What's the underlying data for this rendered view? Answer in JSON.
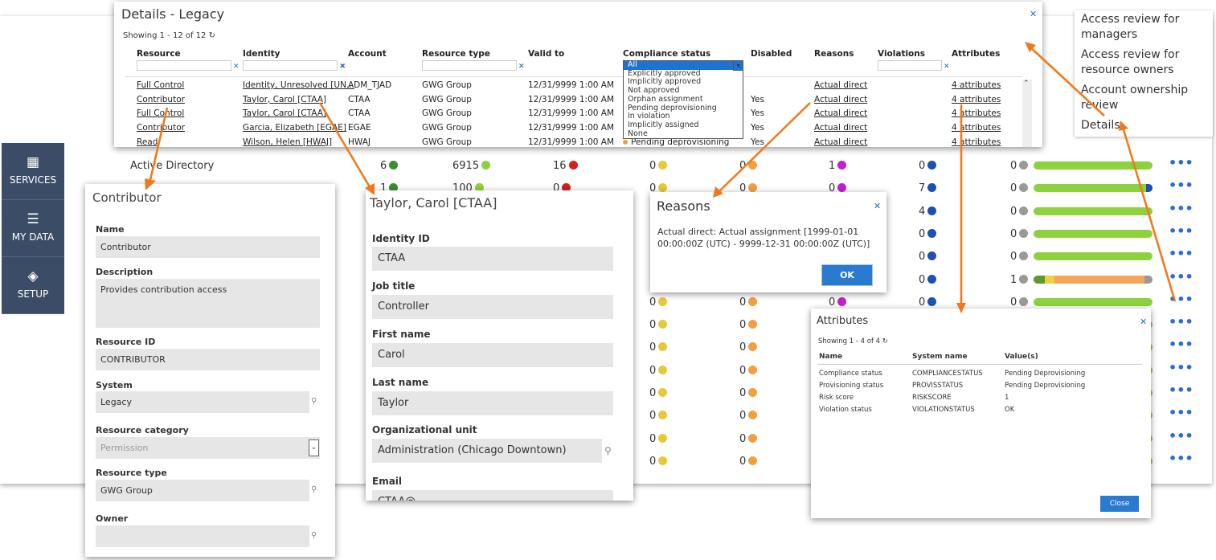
{
  "nav": [
    {
      "icon": "grid-icon",
      "label": "SERVICES"
    },
    {
      "icon": "list-icon",
      "label": "MY DATA"
    },
    {
      "icon": "layers-icon",
      "label": "SETUP"
    }
  ],
  "bg_rows": [
    {
      "system": "Active Directory",
      "c1": "6",
      "c2": "6915",
      "c3": "16",
      "c4": "0",
      "c5": "0",
      "c6": "1",
      "c7": "0",
      "c8": "0"
    },
    {
      "system": "",
      "c1": "1",
      "c2": "100",
      "c3": "0",
      "c4": "0",
      "c5": "0",
      "c6": "0",
      "c7": "7",
      "c8": "0"
    },
    {
      "system": "",
      "c1": "",
      "c2": "",
      "c3": "",
      "c4": "",
      "c5": "",
      "c6": "",
      "c7": "4",
      "c8": "0"
    },
    {
      "system": "",
      "c1": "",
      "c2": "",
      "c3": "",
      "c4": "",
      "c5": "",
      "c6": "",
      "c7": "0",
      "c8": "0"
    },
    {
      "system": "",
      "c1": "",
      "c2": "",
      "c3": "",
      "c4": "",
      "c5": "",
      "c6": "",
      "c7": "0",
      "c8": "0"
    },
    {
      "system": "",
      "c1": "",
      "c2": "",
      "c3": "",
      "c4": "",
      "c5": "",
      "c6": "",
      "c7": "0",
      "c8": "1"
    },
    {
      "system": "",
      "c1": "",
      "c2": "",
      "c3": "",
      "c4": "0",
      "c5": "0",
      "c6": "0",
      "c7": "0",
      "c8": "0"
    },
    {
      "system": "",
      "c1": "",
      "c2": "",
      "c3": "",
      "c4": "0",
      "c5": "0",
      "c6": "",
      "c7": "",
      "c8": ""
    },
    {
      "system": "",
      "c1": "",
      "c2": "",
      "c3": "",
      "c4": "0",
      "c5": "0",
      "c6": "",
      "c7": "",
      "c8": ""
    },
    {
      "system": "",
      "c1": "",
      "c2": "",
      "c3": "",
      "c4": "0",
      "c5": "0",
      "c6": "",
      "c7": "",
      "c8": ""
    },
    {
      "system": "",
      "c1": "",
      "c2": "",
      "c3": "",
      "c4": "0",
      "c5": "0",
      "c6": "",
      "c7": "",
      "c8": ""
    },
    {
      "system": "",
      "c1": "",
      "c2": "",
      "c3": "",
      "c4": "0",
      "c5": "0",
      "c6": "",
      "c7": "",
      "c8": ""
    },
    {
      "system": "",
      "c1": "",
      "c2": "",
      "c3": "",
      "c4": "0",
      "c5": "0",
      "c6": "",
      "c7": "",
      "c8": ""
    },
    {
      "system": "",
      "c1": "",
      "c2": "",
      "c3": "",
      "c4": "0",
      "c5": "0",
      "c6": "",
      "c7": "",
      "c8": ""
    }
  ],
  "context_menu": [
    "Access review for managers",
    "Access review for resource owners",
    "Account ownership review",
    "Details"
  ],
  "details": {
    "title": "Details - Legacy",
    "showing": "Showing 1 - 12 of 12",
    "columns": [
      "Resource",
      "Identity",
      "Account",
      "Resource type",
      "Valid to",
      "Compliance status",
      "Disabled",
      "Reasons",
      "Violations",
      "Attributes"
    ],
    "compliance_selected": "All",
    "compliance_options": [
      "All",
      "Explicitly approved",
      "Implicitly approved",
      "Not approved",
      "Orphan assignment",
      "Pending deprovisioning",
      "In violation",
      "Implicitly assigned",
      "None"
    ],
    "rows": [
      {
        "resource": "Full Control",
        "identity": "Identity, Unresolved [UN...",
        "account": "ADM_TJAD",
        "type": "GWG Group",
        "valid": "12/31/9999 1:00 AM",
        "status": "",
        "disabled": "",
        "reasons": "Actual direct",
        "attrs": "4 attributes"
      },
      {
        "resource": "Contributor",
        "identity": "Taylor, Carol [CTAA]",
        "account": "CTAA",
        "type": "GWG Group",
        "valid": "12/31/9999 1:00 AM",
        "status": "",
        "disabled": "Yes",
        "reasons": "Actual direct",
        "attrs": "4 attributes"
      },
      {
        "resource": "Full Control",
        "identity": "Taylor, Carol [CTAA]",
        "account": "CTAA",
        "type": "GWG Group",
        "valid": "12/31/9999 1:00 AM",
        "status": "",
        "disabled": "Yes",
        "reasons": "Actual direct",
        "attrs": "4 attributes"
      },
      {
        "resource": "Contributor",
        "identity": "Garcia, Elizabeth [EGAE]",
        "account": "EGAE",
        "type": "GWG Group",
        "valid": "12/31/9999 1:00 AM",
        "status": "",
        "disabled": "Yes",
        "reasons": "Actual direct",
        "attrs": "4 attributes"
      },
      {
        "resource": "Read",
        "identity": "Wilson, Helen [HWAJ]",
        "account": "HWAJ",
        "type": "GWG Group",
        "valid": "12/31/9999 1:00 AM",
        "status": "Pending deprovisioning",
        "disabled": "Yes",
        "reasons": "Actual direct",
        "attrs": "4 attributes"
      }
    ]
  },
  "contributor": {
    "title": "Contributor",
    "name_label": "Name",
    "name": "Contributor",
    "desc_label": "Description",
    "desc": "Provides contribution access",
    "rid_label": "Resource ID",
    "rid": "CONTRIBUTOR",
    "system_label": "System",
    "system": "Legacy",
    "cat_label": "Resource category",
    "cat": "Permission",
    "type_label": "Resource type",
    "type": "GWG Group",
    "owner_label": "Owner",
    "owner": ""
  },
  "identity": {
    "title": "Taylor, Carol [CTAA]",
    "id_label": "Identity ID",
    "id": "CTAA",
    "job_label": "Job title",
    "job": "Controller",
    "first_label": "First name",
    "first": "Carol",
    "last_label": "Last name",
    "last": "Taylor",
    "org_label": "Organizational unit",
    "org": "Administration (Chicago Downtown)",
    "email_label": "Email",
    "email": "CTAA@"
  },
  "reasons": {
    "title": "Reasons",
    "text": "Actual direct: Actual assignment [1999-01-01 00:00:00Z (UTC) - 9999-12-31 00:00:00Z (UTC)]",
    "ok": "OK"
  },
  "attributes": {
    "title": "Attributes",
    "showing": "Showing 1 - 4 of 4",
    "columns": [
      "Name",
      "System name",
      "Value(s)"
    ],
    "rows": [
      {
        "name": "Compliance status",
        "sys": "COMPLIANCESTATUS",
        "val": "Pending Deprovisioning"
      },
      {
        "name": "Provisioning status",
        "sys": "PROVISSTATUS",
        "val": "Pending Deprovisioning"
      },
      {
        "name": "Risk score",
        "sys": "RISKSCORE",
        "val": "1"
      },
      {
        "name": "Violation status",
        "sys": "VIOLATIONSTATUS",
        "val": "OK"
      }
    ],
    "close": "Close"
  }
}
